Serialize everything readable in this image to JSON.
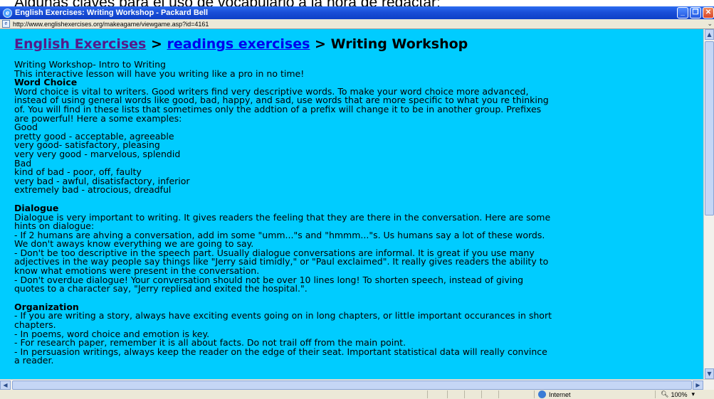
{
  "slide_caption": "Algunas claves para el uso de vocabulario a la hora de redactar:",
  "window": {
    "title": "English Exercises: Writing Workshop - Packard Bell",
    "buttons": [
      "minimize",
      "maximize",
      "close"
    ]
  },
  "address": {
    "url": "http://www.englishexercises.org/makeagame/viewgame.asp?id=4161"
  },
  "breadcrumb": {
    "home": "English Exercises",
    "sep1": " > ",
    "section": "readings exercises",
    "sep2": " > ",
    "current": "Writing Workshop"
  },
  "content": {
    "lines": [
      {
        "text": "Writing Workshop- Intro to Writing",
        "bold": false
      },
      {
        "text": "This interactive lesson will have you writing like a pro in no time!",
        "bold": false
      },
      {
        "text": "Word Choice",
        "bold": true
      },
      {
        "text": "Word choice is vital to writers. Good writers find very descriptive words. To make your word choice more advanced,",
        "bold": false
      },
      {
        "text": "instead of using general words like good, bad, happy, and sad, use words that are more specific to what you re thinking",
        "bold": false
      },
      {
        "text": "of. You will find in these lists that sometimes only the addtion of a prefix will change it to be in another group. Prefixes",
        "bold": false
      },
      {
        "text": "are powerful! Here a some examples:",
        "bold": false
      },
      {
        "text": "Good",
        "bold": false
      },
      {
        "text": "pretty good - acceptable, agreeable",
        "bold": false
      },
      {
        "text": "very good- satisfactory, pleasing",
        "bold": false
      },
      {
        "text": "very very good - marvelous, splendid",
        "bold": false
      },
      {
        "text": "Bad",
        "bold": false
      },
      {
        "text": "kind of bad - poor, off, faulty",
        "bold": false
      },
      {
        "text": "very bad - awful, disatisfactory, inferior",
        "bold": false
      },
      {
        "text": "extremely bad - atrocious, dreadful",
        "bold": false
      },
      {
        "text": "",
        "bold": false,
        "gap": true
      },
      {
        "text": "Dialogue",
        "bold": true
      },
      {
        "text": "Dialogue is very important to writing. It gives readers the feeling that they are there in the conversation. Here are some",
        "bold": false
      },
      {
        "text": "hints on dialogue:",
        "bold": false
      },
      {
        "text": "- If 2 humans are ahving a conversation, add im some \"umm...\"s and \"hmmm...\"s. Us humans say a lot of these words.",
        "bold": false
      },
      {
        "text": "We don't aways know everything we are going to say.",
        "bold": false
      },
      {
        "text": "- Don't be too descriptive in the speech part. Usually dialogue conversations are informal. It is great if you use many",
        "bold": false
      },
      {
        "text": "adjectives in the way people say things like \"Jerry said timidly,\" or \"Paul exclaimed\". It really gives readers the ability to",
        "bold": false
      },
      {
        "text": "know what emotions were present in the conversation.",
        "bold": false
      },
      {
        "text": "- Don't overdue dialogue! Your conversation should not be over 10 lines long! To shorten speech, instead of giving",
        "bold": false
      },
      {
        "text": "quotes to a character say, \"Jerry replied and exited the hospital.\".",
        "bold": false
      },
      {
        "text": "",
        "bold": false,
        "gap": true
      },
      {
        "text": "Organization",
        "bold": true
      },
      {
        "text": "- If you are writing a story, always have exciting events going on in long chapters, or little important occurances in short",
        "bold": false
      },
      {
        "text": "chapters.",
        "bold": false
      },
      {
        "text": "- In poems, word choice and emotion is key.",
        "bold": false
      },
      {
        "text": "- For research paper, remember it is all about facts. Do not trail off from the main point.",
        "bold": false
      },
      {
        "text": "- In persuasion writings, always keep the reader on the edge of their seat. Important statistical data will really convince",
        "bold": false
      },
      {
        "text": "a reader.",
        "bold": false
      }
    ]
  },
  "statusbar": {
    "zone": "Internet",
    "zoom": "100%"
  },
  "colors": {
    "page_background": "#00ccff",
    "link": "#0000ee",
    "visited_link": "#551a8b",
    "titlebar": "#0d3fc7"
  }
}
